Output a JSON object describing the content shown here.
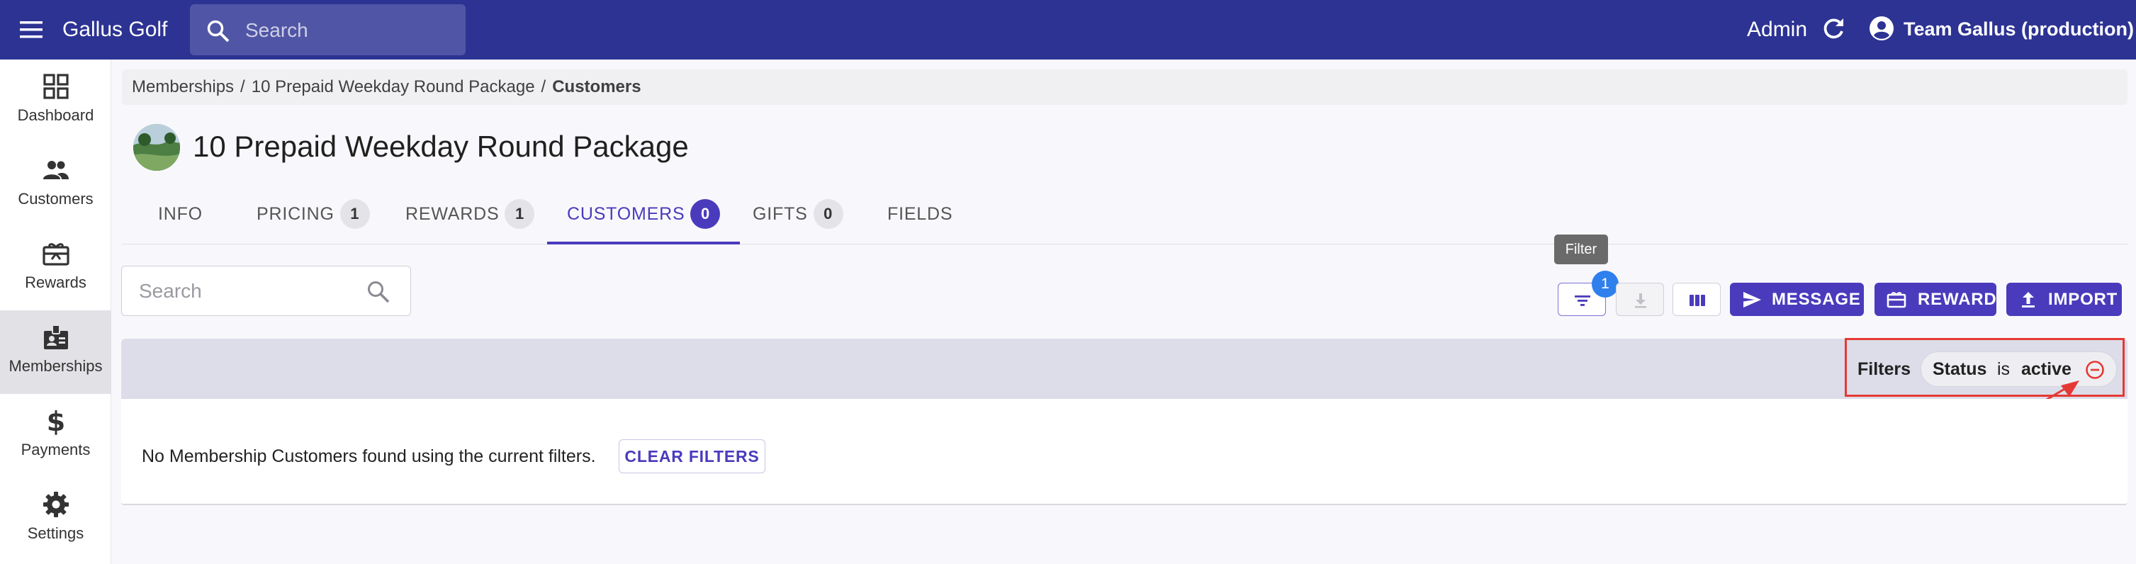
{
  "appbar": {
    "brand": "Gallus Golf",
    "search_placeholder": "Search",
    "admin_label": "Admin",
    "team_label": "Team Gallus (production)"
  },
  "sidebar": {
    "items": [
      {
        "label": "Dashboard",
        "icon": "dashboard-icon"
      },
      {
        "label": "Customers",
        "icon": "people-icon"
      },
      {
        "label": "Rewards",
        "icon": "gift-card-icon"
      },
      {
        "label": "Memberships",
        "icon": "badge-icon",
        "active": true
      },
      {
        "label": "Payments",
        "icon": "dollar-icon"
      },
      {
        "label": "Settings",
        "icon": "gear-icon"
      }
    ]
  },
  "breadcrumb": {
    "items": [
      "Memberships",
      "10 Prepaid Weekday Round Package"
    ],
    "current": "Customers",
    "separator": "/"
  },
  "page": {
    "title": "10 Prepaid Weekday Round Package"
  },
  "tabs": [
    {
      "label": "INFO"
    },
    {
      "label": "PRICING",
      "count": "1"
    },
    {
      "label": "REWARDS",
      "count": "1"
    },
    {
      "label": "CUSTOMERS",
      "count": "0",
      "active": true
    },
    {
      "label": "GIFTS",
      "count": "0"
    },
    {
      "label": "FIELDS"
    }
  ],
  "toolbar": {
    "search_placeholder": "Search",
    "tooltip": "Filter",
    "filter_badge": "1",
    "message_label": "MESSAGE",
    "reward_label": "REWARD",
    "import_label": "IMPORT"
  },
  "filters": {
    "label": "Filters",
    "chip": {
      "field": "Status",
      "operator": "is",
      "value": "active"
    }
  },
  "table": {
    "empty_text": "No Membership Customers found using the current filters.",
    "clear_filters_label": "CLEAR FILTERS"
  },
  "colors": {
    "appbar": "#2d3393",
    "accent": "#4a3bbd",
    "badge": "#2f80ed",
    "annotation": "#e53935"
  }
}
